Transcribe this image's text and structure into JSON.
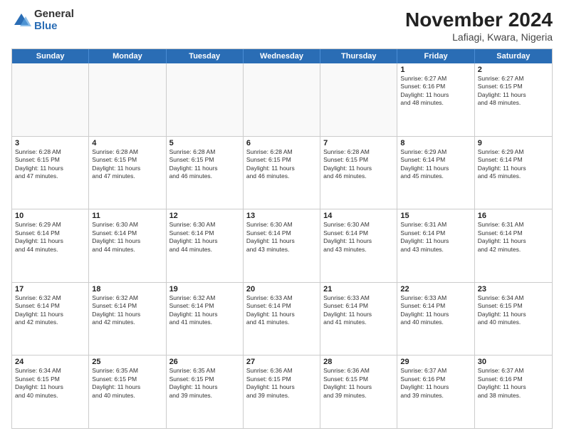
{
  "logo": {
    "general": "General",
    "blue": "Blue"
  },
  "title": {
    "month": "November 2024",
    "location": "Lafiagi, Kwara, Nigeria"
  },
  "header_days": [
    "Sunday",
    "Monday",
    "Tuesday",
    "Wednesday",
    "Thursday",
    "Friday",
    "Saturday"
  ],
  "weeks": [
    [
      {
        "day": "",
        "info": ""
      },
      {
        "day": "",
        "info": ""
      },
      {
        "day": "",
        "info": ""
      },
      {
        "day": "",
        "info": ""
      },
      {
        "day": "",
        "info": ""
      },
      {
        "day": "1",
        "info": "Sunrise: 6:27 AM\nSunset: 6:16 PM\nDaylight: 11 hours\nand 48 minutes."
      },
      {
        "day": "2",
        "info": "Sunrise: 6:27 AM\nSunset: 6:15 PM\nDaylight: 11 hours\nand 48 minutes."
      }
    ],
    [
      {
        "day": "3",
        "info": "Sunrise: 6:28 AM\nSunset: 6:15 PM\nDaylight: 11 hours\nand 47 minutes."
      },
      {
        "day": "4",
        "info": "Sunrise: 6:28 AM\nSunset: 6:15 PM\nDaylight: 11 hours\nand 47 minutes."
      },
      {
        "day": "5",
        "info": "Sunrise: 6:28 AM\nSunset: 6:15 PM\nDaylight: 11 hours\nand 46 minutes."
      },
      {
        "day": "6",
        "info": "Sunrise: 6:28 AM\nSunset: 6:15 PM\nDaylight: 11 hours\nand 46 minutes."
      },
      {
        "day": "7",
        "info": "Sunrise: 6:28 AM\nSunset: 6:15 PM\nDaylight: 11 hours\nand 46 minutes."
      },
      {
        "day": "8",
        "info": "Sunrise: 6:29 AM\nSunset: 6:14 PM\nDaylight: 11 hours\nand 45 minutes."
      },
      {
        "day": "9",
        "info": "Sunrise: 6:29 AM\nSunset: 6:14 PM\nDaylight: 11 hours\nand 45 minutes."
      }
    ],
    [
      {
        "day": "10",
        "info": "Sunrise: 6:29 AM\nSunset: 6:14 PM\nDaylight: 11 hours\nand 44 minutes."
      },
      {
        "day": "11",
        "info": "Sunrise: 6:30 AM\nSunset: 6:14 PM\nDaylight: 11 hours\nand 44 minutes."
      },
      {
        "day": "12",
        "info": "Sunrise: 6:30 AM\nSunset: 6:14 PM\nDaylight: 11 hours\nand 44 minutes."
      },
      {
        "day": "13",
        "info": "Sunrise: 6:30 AM\nSunset: 6:14 PM\nDaylight: 11 hours\nand 43 minutes."
      },
      {
        "day": "14",
        "info": "Sunrise: 6:30 AM\nSunset: 6:14 PM\nDaylight: 11 hours\nand 43 minutes."
      },
      {
        "day": "15",
        "info": "Sunrise: 6:31 AM\nSunset: 6:14 PM\nDaylight: 11 hours\nand 43 minutes."
      },
      {
        "day": "16",
        "info": "Sunrise: 6:31 AM\nSunset: 6:14 PM\nDaylight: 11 hours\nand 42 minutes."
      }
    ],
    [
      {
        "day": "17",
        "info": "Sunrise: 6:32 AM\nSunset: 6:14 PM\nDaylight: 11 hours\nand 42 minutes."
      },
      {
        "day": "18",
        "info": "Sunrise: 6:32 AM\nSunset: 6:14 PM\nDaylight: 11 hours\nand 42 minutes."
      },
      {
        "day": "19",
        "info": "Sunrise: 6:32 AM\nSunset: 6:14 PM\nDaylight: 11 hours\nand 41 minutes."
      },
      {
        "day": "20",
        "info": "Sunrise: 6:33 AM\nSunset: 6:14 PM\nDaylight: 11 hours\nand 41 minutes."
      },
      {
        "day": "21",
        "info": "Sunrise: 6:33 AM\nSunset: 6:14 PM\nDaylight: 11 hours\nand 41 minutes."
      },
      {
        "day": "22",
        "info": "Sunrise: 6:33 AM\nSunset: 6:14 PM\nDaylight: 11 hours\nand 40 minutes."
      },
      {
        "day": "23",
        "info": "Sunrise: 6:34 AM\nSunset: 6:15 PM\nDaylight: 11 hours\nand 40 minutes."
      }
    ],
    [
      {
        "day": "24",
        "info": "Sunrise: 6:34 AM\nSunset: 6:15 PM\nDaylight: 11 hours\nand 40 minutes."
      },
      {
        "day": "25",
        "info": "Sunrise: 6:35 AM\nSunset: 6:15 PM\nDaylight: 11 hours\nand 40 minutes."
      },
      {
        "day": "26",
        "info": "Sunrise: 6:35 AM\nSunset: 6:15 PM\nDaylight: 11 hours\nand 39 minutes."
      },
      {
        "day": "27",
        "info": "Sunrise: 6:36 AM\nSunset: 6:15 PM\nDaylight: 11 hours\nand 39 minutes."
      },
      {
        "day": "28",
        "info": "Sunrise: 6:36 AM\nSunset: 6:15 PM\nDaylight: 11 hours\nand 39 minutes."
      },
      {
        "day": "29",
        "info": "Sunrise: 6:37 AM\nSunset: 6:16 PM\nDaylight: 11 hours\nand 39 minutes."
      },
      {
        "day": "30",
        "info": "Sunrise: 6:37 AM\nSunset: 6:16 PM\nDaylight: 11 hours\nand 38 minutes."
      }
    ]
  ]
}
